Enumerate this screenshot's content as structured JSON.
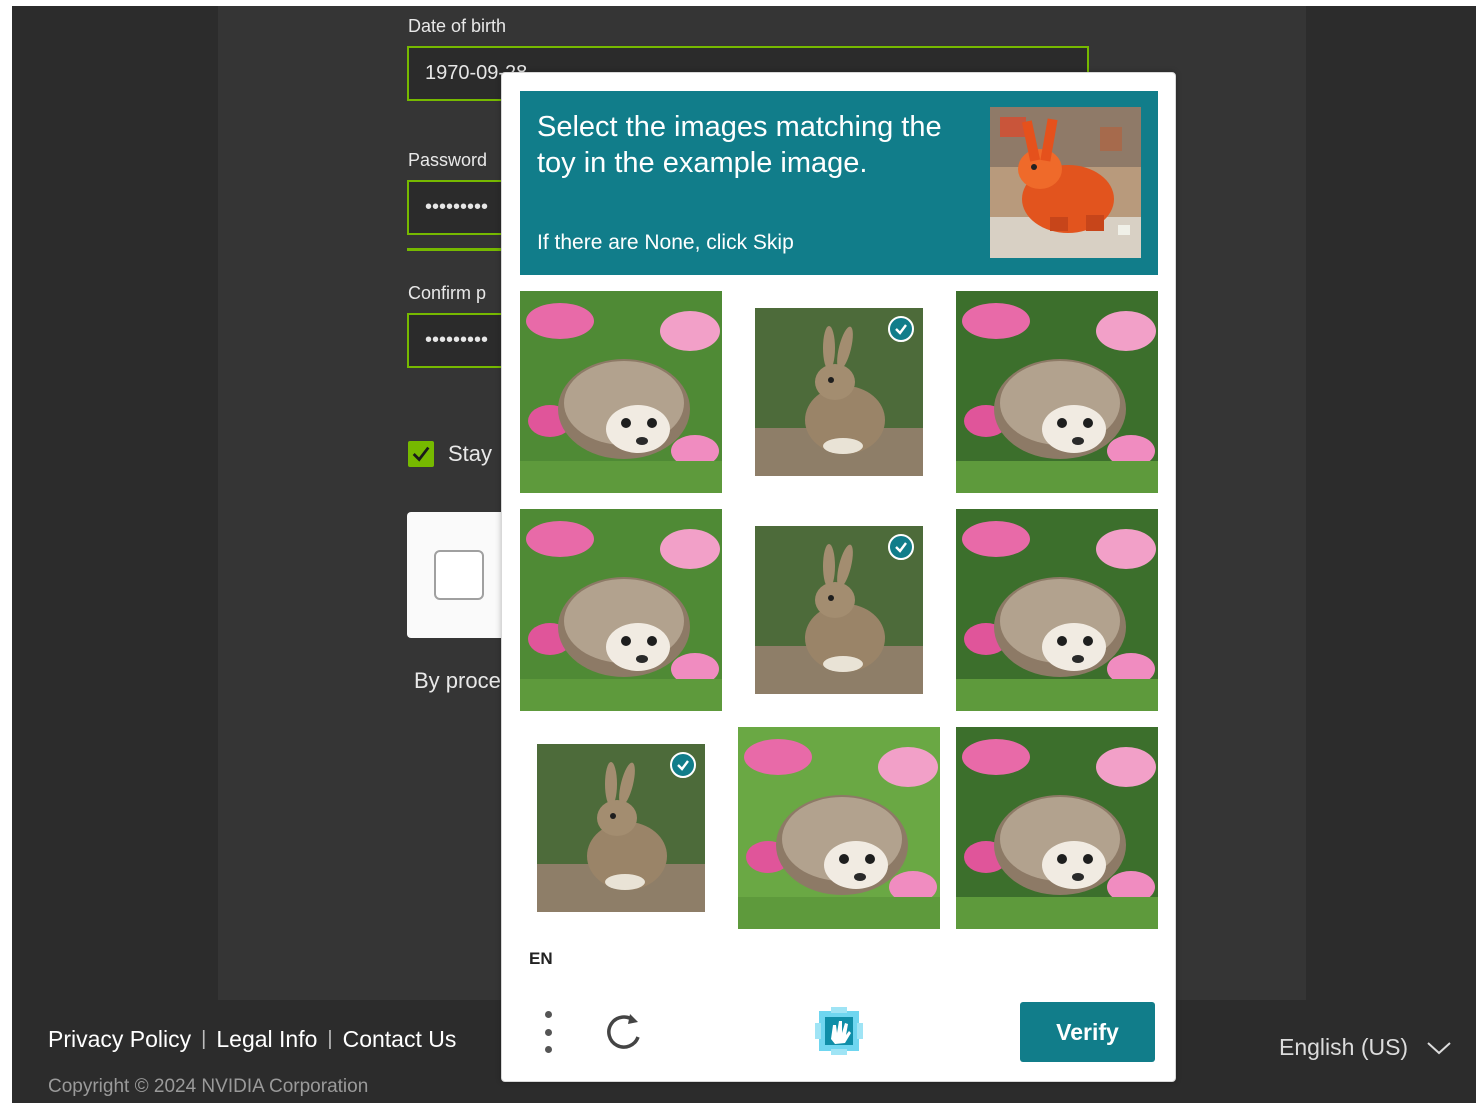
{
  "form": {
    "dob_label": "Date of birth",
    "dob_value": "1970-09-28",
    "password_label": "Password",
    "password_value": "•••••••••",
    "confirm_label": "Confirm p",
    "confirm_value": "•••••••••",
    "stay_label": "Stay",
    "by_text": "By proce"
  },
  "footer": {
    "links": [
      "Privacy Policy",
      "Legal Info",
      "Contact Us"
    ],
    "copyright": "Copyright © 2024 NVIDIA Corporation",
    "language": "English (US)"
  },
  "challenge": {
    "prompt": "Select the images matching the toy in the example image.",
    "sub": "If there are None, click Skip",
    "example_icon": "toy-rabbit-image",
    "tiles": [
      {
        "subject": "hedgehog",
        "selected": false
      },
      {
        "subject": "rabbit",
        "selected": true
      },
      {
        "subject": "hedgehog",
        "selected": false
      },
      {
        "subject": "hedgehog",
        "selected": false
      },
      {
        "subject": "rabbit",
        "selected": true
      },
      {
        "subject": "hedgehog",
        "selected": false
      },
      {
        "subject": "rabbit",
        "selected": true
      },
      {
        "subject": "hedgehog",
        "selected": false
      },
      {
        "subject": "hedgehog",
        "selected": false
      }
    ],
    "language_code": "EN",
    "verify_label": "Verify"
  },
  "colors": {
    "accent_green": "#76b900",
    "hcaptcha_teal": "#117d8a",
    "page_bg": "#2c2c2c"
  }
}
